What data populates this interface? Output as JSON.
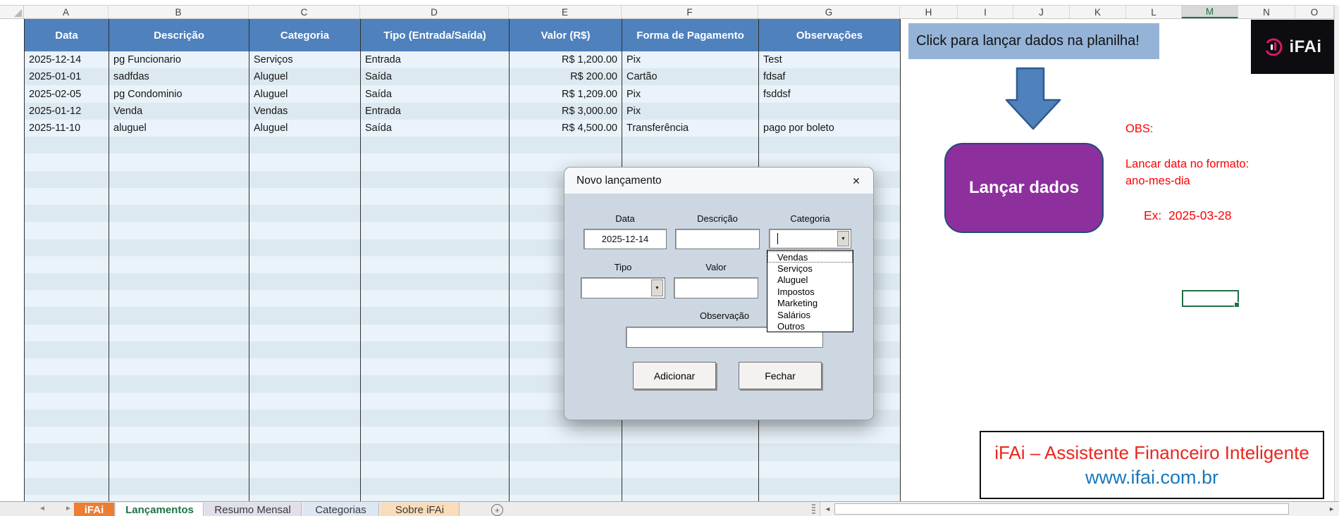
{
  "grid": {
    "column_letters": [
      "A",
      "B",
      "C",
      "D",
      "E",
      "F",
      "G",
      "H",
      "I",
      "J",
      "K",
      "L",
      "M",
      "N",
      "O"
    ],
    "visible_rows": 28,
    "selected_column": "M",
    "selected_row": 16
  },
  "table": {
    "headers": [
      "Data",
      "Descrição",
      "Categoria",
      "Tipo (Entrada/Saída)",
      "Valor (R$)",
      "Forma de Pagamento",
      "Observações"
    ],
    "rows": [
      [
        "2025-12-14",
        "pg Funcionario",
        "Serviços",
        "Entrada",
        "R$ 1,200.00",
        "Pix",
        "Test"
      ],
      [
        "2025-01-01",
        "sadfdas",
        "Aluguel",
        "Saída",
        "R$ 200.00",
        "Cartão",
        "fdsaf"
      ],
      [
        "2025-02-05",
        "pg Condominio",
        "Aluguel",
        "Saída",
        "R$ 1,209.00",
        "Pix",
        "fsddsf"
      ],
      [
        "2025-01-12",
        "Venda",
        "Vendas",
        "Entrada",
        "R$ 3,000.00",
        "Pix",
        ""
      ],
      [
        "2025-11-10",
        "aluguel",
        "Aluguel",
        "Saída",
        "R$ 4,500.00",
        "Transferência",
        "pago por boleto"
      ]
    ]
  },
  "side_panel": {
    "click_banner": "Click para lançar dados na planilha!",
    "launch_button": "Lançar dados",
    "obs_title": "OBS:",
    "obs_line1": "Lancar data no formato:",
    "obs_line2": "ano-mes-dia",
    "obs_example": "Ex:  2025-03-28",
    "logo_text": "iFAi"
  },
  "footer_box": {
    "line1": "iFAi – Assistente Financeiro Inteligente",
    "line2": "www.ifai.com.br"
  },
  "dialog": {
    "title": "Novo lançamento",
    "fields": {
      "data_label": "Data",
      "data_value": "2025-12-14",
      "descricao_label": "Descrição",
      "categoria_label": "Categoria",
      "tipo_label": "Tipo",
      "valor_label": "Valor",
      "observacao_label": "Observação"
    },
    "category_options": [
      "Vendas",
      "Serviços",
      "Aluguel",
      "Impostos",
      "Marketing",
      "Salários",
      "Outros"
    ],
    "buttons": {
      "add": "Adicionar",
      "close": "Fechar"
    }
  },
  "tabs": {
    "items": [
      {
        "label": "iFAi",
        "type": "orange"
      },
      {
        "label": "Lançamentos",
        "type": "active"
      },
      {
        "label": "Resumo Mensal",
        "type": "lavender"
      },
      {
        "label": "Categorias",
        "type": "blue"
      },
      {
        "label": "Sobre iFAi",
        "type": "peach"
      }
    ]
  },
  "icons": {
    "close": "✕",
    "dropdown": "▼",
    "nav_left": "◄",
    "nav_right": "►",
    "plus": "+"
  },
  "colors": {
    "header_blue": "#4f81bd",
    "row_light": "#e9f3f9",
    "row_dark": "#dde9f0",
    "banner_blue": "#95b3d7",
    "arrow_blue": "#4f81bd",
    "arrow_border": "#2e5b8f",
    "purple": "#8e2f9e",
    "purple_border": "#1f4e79",
    "obs_red": "#ff0000",
    "footer_red": "#e8271e",
    "url_blue": "#1878be",
    "excel_green": "#1e7145",
    "tab_orange": "#ed7d31",
    "dialog_body": "#ccd7e2",
    "logo_pink": "#d81b60"
  }
}
